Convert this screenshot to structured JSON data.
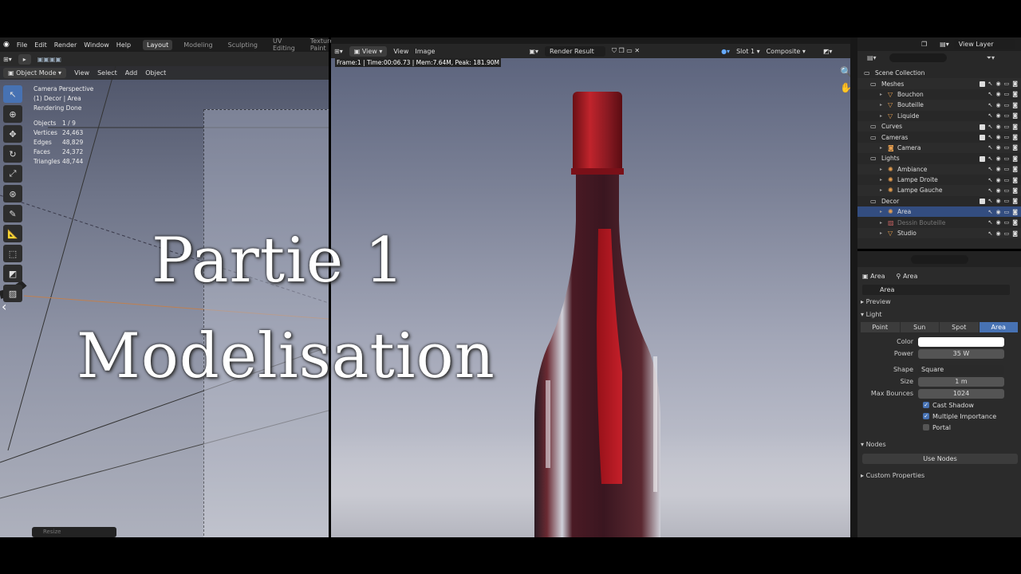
{
  "menu": [
    "File",
    "Edit",
    "Render",
    "Window",
    "Help"
  ],
  "workspaces": [
    {
      "label": "Layout",
      "active": true
    },
    {
      "label": "Modeling",
      "active": false
    },
    {
      "label": "Sculpting",
      "active": false
    },
    {
      "label": "UV Editing",
      "active": false
    },
    {
      "label": "Texture Paint",
      "active": false
    },
    {
      "label": "Sh",
      "active": false
    }
  ],
  "viewport": {
    "mode": "Object Mode",
    "menus": [
      "View",
      "Select",
      "Add",
      "Object"
    ],
    "info": [
      "Camera Perspective",
      "(1) Decor | Area",
      "Rendering Done"
    ],
    "stats": [
      {
        "k": "Objects",
        "v": "1 / 9"
      },
      {
        "k": "Vertices",
        "v": "24,463"
      },
      {
        "k": "Edges",
        "v": "48,829"
      },
      {
        "k": "Faces",
        "v": "24,372"
      },
      {
        "k": "Triangles",
        "v": "48,744"
      }
    ],
    "resize_label": "Resize"
  },
  "title": {
    "line1": "Partie 1",
    "line2": "Modelisation"
  },
  "render": {
    "menus": [
      "View",
      "View",
      "Image"
    ],
    "image_name": "Render Result",
    "slot": "Slot 1",
    "layer": "Composite",
    "frame_info": "Frame:1 | Time:00:06.73 | Mem:7.64M, Peak: 181.90M"
  },
  "outliner": {
    "view_layer": "View Layer",
    "items": [
      {
        "label": "Scene Collection",
        "indent": 0,
        "icon": "collection-icon",
        "checkbox": false
      },
      {
        "label": "Meshes",
        "indent": 1,
        "icon": "collection-icon",
        "checkbox": true
      },
      {
        "label": "Bouchon",
        "indent": 2,
        "icon": "mesh-icon",
        "checkbox": false
      },
      {
        "label": "Bouteille",
        "indent": 2,
        "icon": "mesh-icon",
        "checkbox": false
      },
      {
        "label": "Liquide",
        "indent": 2,
        "icon": "mesh-icon",
        "checkbox": false
      },
      {
        "label": "Curves",
        "indent": 1,
        "icon": "collection-icon",
        "checkbox": true
      },
      {
        "label": "Cameras",
        "indent": 1,
        "icon": "collection-icon",
        "checkbox": true
      },
      {
        "label": "Camera",
        "indent": 2,
        "icon": "camera-icon",
        "checkbox": false
      },
      {
        "label": "Lights",
        "indent": 1,
        "icon": "collection-icon",
        "checkbox": true
      },
      {
        "label": "Ambiance",
        "indent": 2,
        "icon": "light-icon",
        "checkbox": false
      },
      {
        "label": "Lampe Droite",
        "indent": 2,
        "icon": "light-icon",
        "checkbox": false
      },
      {
        "label": "Lampe Gauche",
        "indent": 2,
        "icon": "light-icon",
        "checkbox": false
      },
      {
        "label": "Decor",
        "indent": 1,
        "icon": "collection-icon",
        "checkbox": true
      },
      {
        "label": "Area",
        "indent": 2,
        "icon": "light-icon",
        "checkbox": false,
        "selected": true
      },
      {
        "label": "Dessin Bouteille",
        "indent": 2,
        "icon": "image-icon",
        "checkbox": false,
        "dim": true
      },
      {
        "label": "Studio",
        "indent": 2,
        "icon": "mesh-icon",
        "checkbox": false
      }
    ]
  },
  "properties": {
    "crumb_object": "Area",
    "crumb_data": "Area",
    "datablock": "Area",
    "sections": {
      "preview": "Preview",
      "light": "Light",
      "nodes": "Nodes",
      "custom": "Custom Properties"
    },
    "types": [
      {
        "label": "Point",
        "on": false
      },
      {
        "label": "Sun",
        "on": false
      },
      {
        "label": "Spot",
        "on": false
      },
      {
        "label": "Area",
        "on": true
      }
    ],
    "color_label": "Color",
    "power_label": "Power",
    "power": "35 W",
    "shape_label": "Shape",
    "shape": "Square",
    "size_label": "Size",
    "size": "1 m",
    "bounces_label": "Max Bounces",
    "bounces": "1024",
    "checks": [
      {
        "label": "Cast Shadow",
        "on": true
      },
      {
        "label": "Multiple Importance",
        "on": true
      },
      {
        "label": "Portal",
        "on": false
      }
    ],
    "use_nodes": "Use Nodes"
  },
  "colors": {
    "accent": "#4772b3",
    "bottle_red": "#8a1a22",
    "cap_red": "#b01a22"
  }
}
